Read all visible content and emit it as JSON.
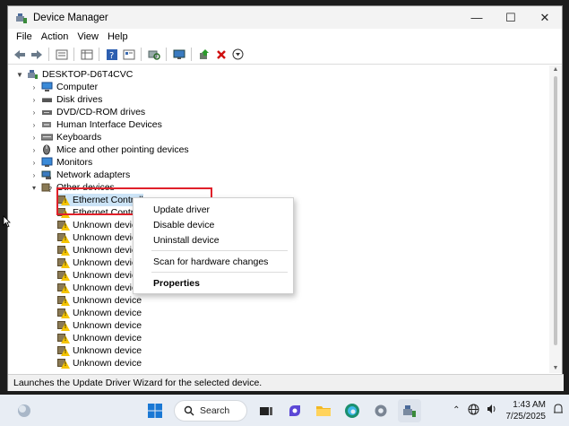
{
  "window": {
    "title": "Device Manager",
    "controls": [
      "—",
      "☐",
      "✕"
    ]
  },
  "menu": [
    "File",
    "Action",
    "View",
    "Help"
  ],
  "toolbar": [
    "back",
    "forward",
    "properties",
    "grid",
    "help",
    "list",
    "scan",
    "monitor",
    "update-driver",
    "uninstall",
    "download"
  ],
  "tree": {
    "root": "DESKTOP-D6T4CVC",
    "categories": [
      {
        "label": "Computer",
        "icon": "computer-icon"
      },
      {
        "label": "Disk drives",
        "icon": "disk-icon"
      },
      {
        "label": "DVD/CD-ROM drives",
        "icon": "dvd-icon"
      },
      {
        "label": "Human Interface Devices",
        "icon": "hid-icon"
      },
      {
        "label": "Keyboards",
        "icon": "keyboard-icon"
      },
      {
        "label": "Mice and other pointing devices",
        "icon": "mouse-icon"
      },
      {
        "label": "Monitors",
        "icon": "monitor-icon"
      },
      {
        "label": "Network adapters",
        "icon": "network-icon"
      },
      {
        "label": "Other devices",
        "icon": "other-devices-icon"
      }
    ],
    "other_devices": [
      "Ethernet Controller",
      "Ethernet Contro",
      "Unknown devic",
      "Unknown devic",
      "Unknown devic",
      "Unknown devic",
      "Unknown devic",
      "Unknown devic",
      "Unknown device",
      "Unknown device",
      "Unknown device",
      "Unknown device",
      "Unknown device",
      "Unknown device"
    ]
  },
  "context_menu": {
    "update": "Update driver",
    "disable": "Disable device",
    "uninstall": "Uninstall device",
    "scan": "Scan for hardware changes",
    "properties": "Properties"
  },
  "status": "Launches the Update Driver Wizard for the selected device.",
  "taskbar": {
    "search": "Search",
    "time": "1:43 AM",
    "date": "7/25/2025"
  },
  "colors": {
    "selection": "#cce4f7",
    "highlight_box": "#e0202a",
    "warning": "#f5c400"
  }
}
